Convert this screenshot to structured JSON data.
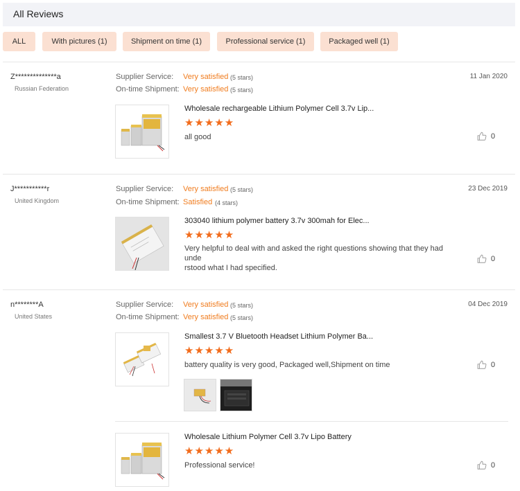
{
  "header": {
    "title": "All Reviews"
  },
  "filters": [
    {
      "label": "ALL"
    },
    {
      "label": "With pictures (1)"
    },
    {
      "label": "Shipment on time (1)"
    },
    {
      "label": "Professional service (1)"
    },
    {
      "label": "Packaged well (1)"
    }
  ],
  "labels": {
    "supplier_service": "Supplier Service:",
    "ontime_shipment": "On-time Shipment:"
  },
  "reviews": [
    {
      "reviewer": "Z**************a",
      "country": "Russian Federation",
      "date": "11 Jan 2020",
      "supplier_service": {
        "value": "Very satisfied",
        "note": "(5 stars)"
      },
      "ontime_shipment": {
        "value": "Very satisfied",
        "note": "(5 stars)"
      },
      "product": "Wholesale rechargeable Lithium Polymer Cell 3.7v Lip...",
      "rating": 5,
      "stars": "★★★★★",
      "text": "all good",
      "likes": "0"
    },
    {
      "reviewer": "J***********r",
      "country": "United Kingdom",
      "date": "23 Dec 2019",
      "supplier_service": {
        "value": "Very satisfied",
        "note": "(5 stars)"
      },
      "ontime_shipment": {
        "value": "Satisfied",
        "note": "(4 stars)"
      },
      "product": "303040 lithium polymer battery 3.7v 300mah for Elec...",
      "rating": 5,
      "stars": "★★★★★",
      "text_line1": "Very helpful to deal with and asked the right questions showing that they had unde",
      "text_line2": "rstood what I had specified.",
      "likes": "0"
    },
    {
      "reviewer": "n********A",
      "country": "United States",
      "date": "04 Dec 2019",
      "supplier_service": {
        "value": "Very satisfied",
        "note": "(5 stars)"
      },
      "ontime_shipment": {
        "value": "Very satisfied",
        "note": "(5 stars)"
      },
      "product": "Smallest 3.7 V Bluetooth Headset Lithium Polymer Ba...",
      "rating": 5,
      "stars": "★★★★★",
      "text": "battery quality is very good, Packaged well,Shipment on time",
      "likes": "0"
    },
    {
      "product": "Wholesale Lithium Polymer Cell 3.7v Lipo Battery",
      "rating": 5,
      "stars": "★★★★★",
      "text": "Professional service!",
      "likes": "0"
    }
  ],
  "colors": {
    "accent": "#f26c1c",
    "chip_bg": "#fbe0d2",
    "header_bg": "#f2f3f7"
  },
  "icons": {
    "like": "thumbs-up-icon"
  }
}
